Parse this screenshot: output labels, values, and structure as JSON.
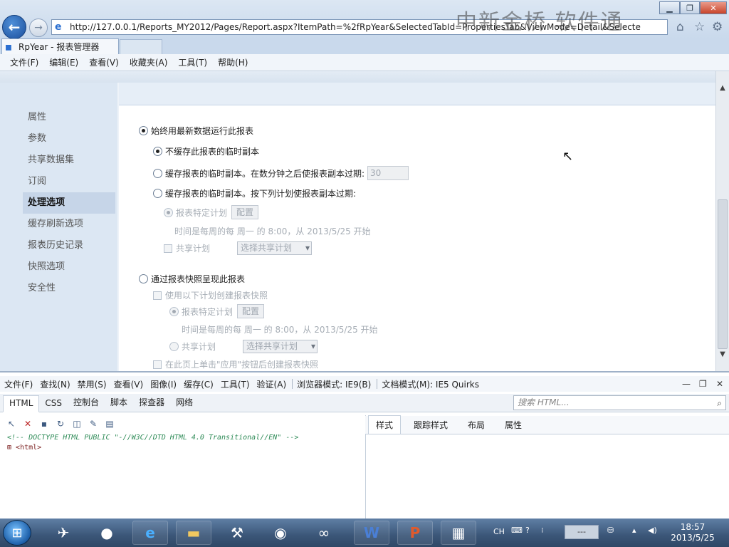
{
  "browser": {
    "url": "http://127.0.0.1/Reports_MY2012/Pages/Report.aspx?ItemPath=%2fRpYear&SelectedTabId=PropertiesTab&ViewMode=Detail&Selecte",
    "watermark": "中新金桥 软件通",
    "tab_title": "RpYear - 报表管理器",
    "window_controls": {
      "minimize": "▁",
      "maximize": "❐",
      "close": "✕"
    },
    "toolbar_icons": [
      "home-icon",
      "favorites-star-icon",
      "tools-gear-icon"
    ]
  },
  "menu": [
    "文件(F)",
    "编辑(E)",
    "查看(V)",
    "收藏夹(A)",
    "工具(T)",
    "帮助(H)"
  ],
  "sidebar": {
    "items": [
      {
        "label": "属性",
        "active": false
      },
      {
        "label": "参数",
        "active": false
      },
      {
        "label": "共享数据集",
        "active": false
      },
      {
        "label": "订阅",
        "active": false
      },
      {
        "label": "处理选项",
        "active": true
      },
      {
        "label": "缓存刷新选项",
        "active": false
      },
      {
        "label": "报表历史记录",
        "active": false
      },
      {
        "label": "快照选项",
        "active": false
      },
      {
        "label": "安全性",
        "active": false
      }
    ]
  },
  "options": {
    "always_latest": "始终用最新数据运行此报表",
    "no_cache": "不缓存此报表的临时副本",
    "cache_minutes": "缓存报表的临时副本。在数分钟之后使报表副本过期:",
    "minutes_value": "30",
    "cache_schedule": "缓存报表的临时副本。按下列计划使报表副本过期:",
    "report_schedule_1": "报表特定计划",
    "configure_1": "配置",
    "schedule_desc_1": "时间是每周的每 周一 的 8:00，从 2013/5/25 开始",
    "shared_schedule_1": "共享计划",
    "select_shared_1": "选择共享计划",
    "snapshot": "通过报表快照呈现此报表",
    "use_schedule_snapshot": "使用以下计划创建报表快照",
    "report_schedule_2": "报表特定计划",
    "configure_2": "配置",
    "schedule_desc_2": "时间是每周的每 周一 的 8:00，从 2013/5/25 开始",
    "shared_schedule_2": "共享计划",
    "select_shared_2": "选择共享计划",
    "on_apply": "在此页上单击\"应用\"按钮后创建报表快照"
  },
  "devtools": {
    "menu": [
      "文件(F)",
      "查找(N)",
      "禁用(S)",
      "查看(V)",
      "图像(I)",
      "缓存(C)",
      "工具(T)",
      "验证(A)",
      "浏览器模式: IE9(B)",
      "文档模式(M): IE5 Quirks"
    ],
    "tabs": [
      "HTML",
      "CSS",
      "控制台",
      "脚本",
      "探查器",
      "网络"
    ],
    "active_tab": "HTML",
    "search_placeholder": "搜索 HTML...",
    "tree_doctype": "<!-- DOCTYPE HTML PUBLIC \"-//W3C//DTD HTML 4.0 Transitional//EN\" -->",
    "tree_html": "<html>",
    "right_tabs": [
      "样式",
      "跟踪样式",
      "布局",
      "属性"
    ],
    "active_right_tab": "样式",
    "window_controls": {
      "minimize": "—",
      "restore": "❐",
      "close": "✕"
    }
  },
  "taskbar": {
    "ime": "CH",
    "volume_label": "---",
    "time": "18:57",
    "date": "2013/5/25"
  }
}
